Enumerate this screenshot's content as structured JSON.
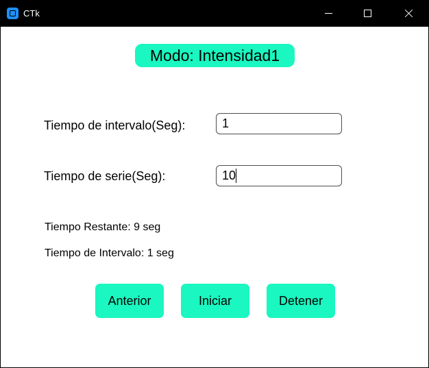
{
  "window": {
    "title": "CTk",
    "icon": "ctk-app-icon"
  },
  "mode": {
    "label": "Modo: Intensidad1"
  },
  "fields": {
    "interval": {
      "label": "Tiempo de intervalo(Seg):",
      "value": "1"
    },
    "serie": {
      "label": "Tiempo de serie(Seg):",
      "value": "10"
    }
  },
  "status": {
    "remaining": "Tiempo Restante: 9 seg",
    "interval": "Tiempo de Intervalo: 1 seg"
  },
  "buttons": {
    "previous": "Anterior",
    "start": "Iniciar",
    "stop": "Detener"
  },
  "colors": {
    "accent": "#1af7c0",
    "titlebar": "#000000",
    "background": "#ffffff"
  }
}
